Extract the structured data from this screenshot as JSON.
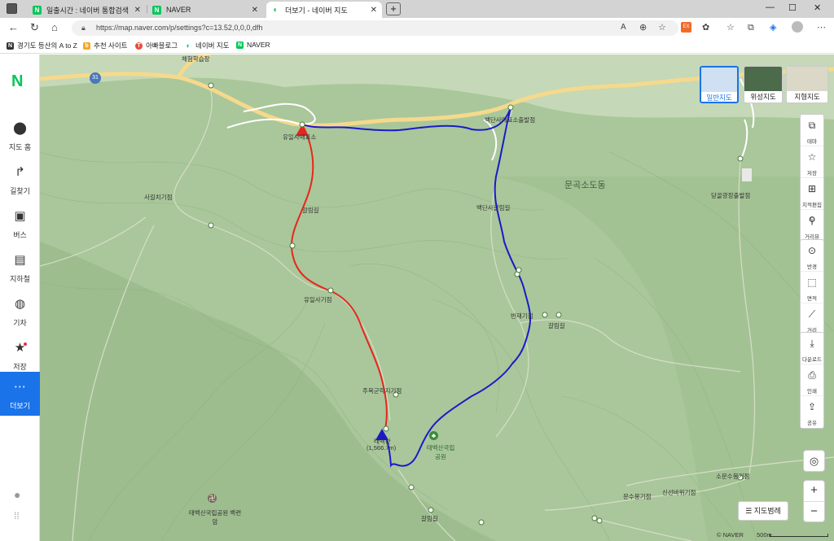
{
  "browser": {
    "tabs": [
      {
        "label": "일출시간 : 네이버 통합검색",
        "icon": "naver-n"
      },
      {
        "label": "NAVER",
        "icon": "naver-n"
      },
      {
        "label": "더보기 - 네이버 지도",
        "icon": "naver-map"
      }
    ],
    "url": "https://map.naver.com/p/settings?c=13.52,0,0,0,dfh",
    "bookmarks": [
      {
        "label": "경기도 등산의 A to Z",
        "color": "#333333"
      },
      {
        "label": "추천 사이트",
        "color": "#f5a623"
      },
      {
        "label": "아빠블로그",
        "color": "#e74c3c"
      },
      {
        "label": "네이버 지도",
        "color": "#03c75a"
      },
      {
        "label": "NAVER",
        "color": "#03c75a"
      }
    ]
  },
  "sidebar": {
    "logo": "N",
    "items": [
      {
        "label": "지도 홈",
        "icon": "map-pin-icon"
      },
      {
        "label": "길찾기",
        "icon": "directions-icon"
      },
      {
        "label": "버스",
        "icon": "bus-icon"
      },
      {
        "label": "지하철",
        "icon": "subway-icon"
      },
      {
        "label": "기차",
        "icon": "train-icon"
      },
      {
        "label": "저장",
        "icon": "star-icon"
      },
      {
        "label": "더보기",
        "icon": "more-icon"
      }
    ]
  },
  "map": {
    "area_label": "문곡소도동",
    "labels": [
      "체험학습장",
      "31",
      "유일사매표소",
      "백단사매표소출발점",
      "사길치기점",
      "갈림길",
      "백단사갈림길",
      "유일사기점",
      "반재기점",
      "갈림길",
      "당골광장출발점",
      "주목군락지기점",
      "태백산",
      "(1,566.7m)",
      "태백산국립공원",
      "태백산국립공원 백련암",
      "소문수봉기점",
      "문수봉기점",
      "신선바위기점",
      "갈림길"
    ],
    "map_types": [
      {
        "label": "일반지도",
        "selected": true
      },
      {
        "label": "위성지도",
        "selected": false
      },
      {
        "label": "지형지도",
        "selected": false
      }
    ],
    "tools_group1": [
      {
        "label": "테마",
        "icon": "layers-icon"
      },
      {
        "label": "저장",
        "icon": "star-outline-icon"
      },
      {
        "label": "지적편집도",
        "icon": "grid-icon"
      },
      {
        "label": "거리뷰",
        "icon": "streetview-icon"
      }
    ],
    "tools_group2": [
      {
        "label": "반경",
        "icon": "radius-icon"
      },
      {
        "label": "면적",
        "icon": "area-icon"
      },
      {
        "label": "거리",
        "icon": "ruler-icon"
      }
    ],
    "tools_group3": [
      {
        "label": "다운로드",
        "icon": "download-icon"
      },
      {
        "label": "인쇄",
        "icon": "print-icon"
      },
      {
        "label": "공유",
        "icon": "share-icon"
      }
    ],
    "legend_button": "지도범례",
    "copyright": "© NAVER",
    "scale": "500m",
    "route_colors": {
      "red": "#e8261e",
      "blue": "#1a1aca"
    }
  }
}
